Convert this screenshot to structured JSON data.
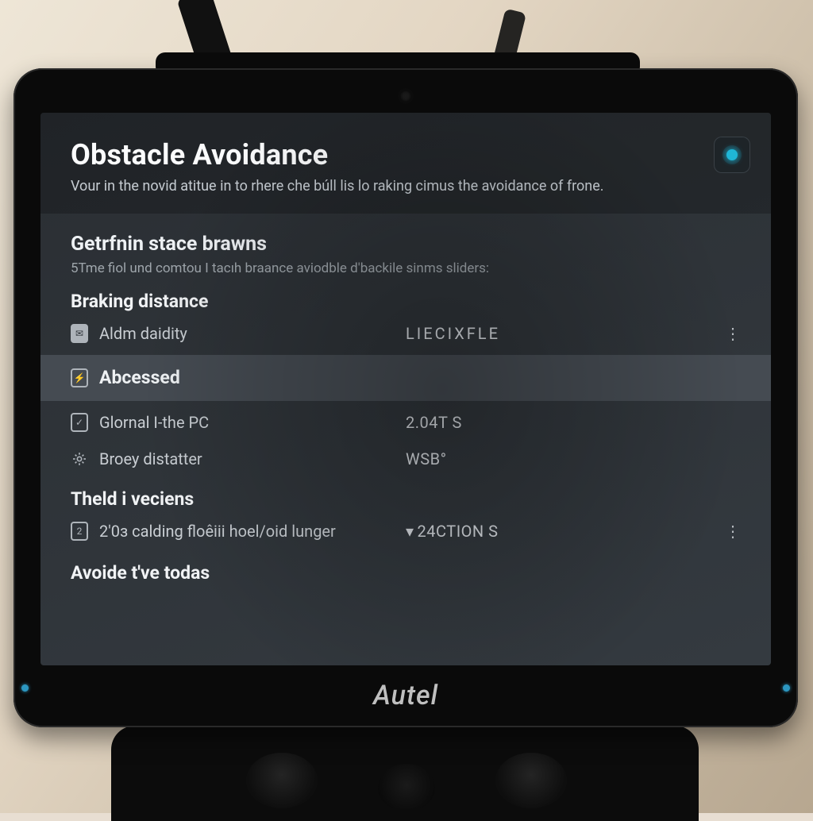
{
  "brand": "Autel",
  "header": {
    "title": "Obstacle Avoidance",
    "subtitle": "Vour in the novid atitue in to rhere che búll lis lo raking cimus the avoidance of frone."
  },
  "section": {
    "title": "Getrfnin stace brawns",
    "desc": "5Tme fiol und comtou I tacıh braance aviodble d'backile sinms sliders:"
  },
  "braking": {
    "title": "Braking distance",
    "rows": [
      {
        "icon": "mail-icon",
        "label": "Aldm daidity",
        "value": "LIECIXFLE"
      },
      {
        "icon": "bolt-icon",
        "label": "Abcessed",
        "value": ""
      },
      {
        "icon": "check-icon",
        "label": "Glornal I-the PC",
        "value": "2.04T S"
      },
      {
        "icon": "gear-icon",
        "label": "Broey distatter",
        "value": "WSB°"
      }
    ]
  },
  "theld": {
    "title": "Theld i veciens",
    "rows": [
      {
        "icon": "num2-icon",
        "label": "2'0з calding floêiii hoel/oid lunger",
        "value": "24CTION S"
      }
    ]
  },
  "footer_title": "Avoide t've todas"
}
